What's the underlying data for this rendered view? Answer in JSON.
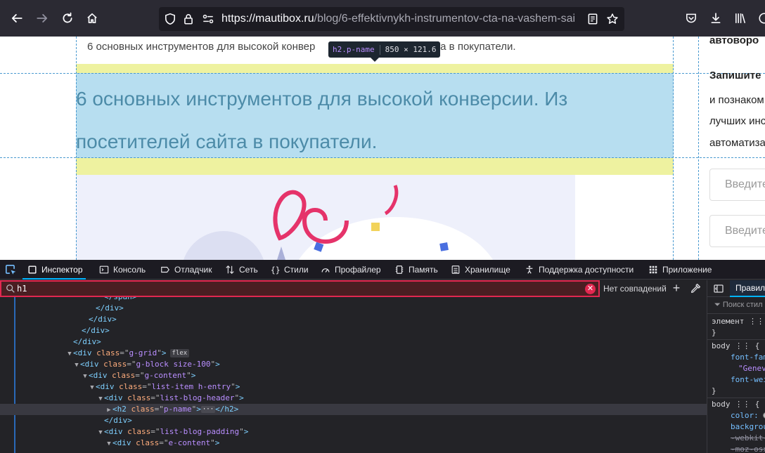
{
  "toolbar": {
    "url_domain": "https://mautibox.ru",
    "url_path": "/blog/6-effektivnykh-instrumentov-cta-na-vashem-sai"
  },
  "page": {
    "breadcrumb": "6 основных инструментов для высокой конвер",
    "breadcrumb_tail": "ей сайта в покупатели.",
    "heading": "6 основных инструментов для высокой конверсии. Из посетителей сайта в покупатели.",
    "tooltip_selector": "h2.p-name",
    "tooltip_size": "850 × 121.6",
    "sidebar": {
      "line1": "автоворо",
      "line2": "Запишите",
      "line3": "и познаком",
      "line4": "лучших инс",
      "line5": "автоматиза",
      "input1_placeholder": "Введите",
      "input2_placeholder": "Введите"
    }
  },
  "devtools": {
    "tabs": [
      {
        "label": "Инспектор",
        "icon": "inspector-icon"
      },
      {
        "label": "Консоль",
        "icon": "console-icon"
      },
      {
        "label": "Отладчик",
        "icon": "debugger-icon"
      },
      {
        "label": "Сеть",
        "icon": "network-icon"
      },
      {
        "label": "Стили",
        "icon": "style-editor-icon"
      },
      {
        "label": "Профайлер",
        "icon": "profiler-icon"
      },
      {
        "label": "Память",
        "icon": "memory-icon"
      },
      {
        "label": "Хранилище",
        "icon": "storage-icon"
      },
      {
        "label": "Поддержка доступности",
        "icon": "accessibility-icon"
      },
      {
        "label": "Приложение",
        "icon": "application-icon"
      }
    ],
    "search_value": "h1",
    "no_match": "Нет совпадений",
    "markup": [
      {
        "t": "close",
        "text": "</span>"
      },
      {
        "t": "close",
        "text": "</div>"
      },
      {
        "t": "close",
        "text": "</div>"
      },
      {
        "t": "close",
        "text": "</div>"
      },
      {
        "t": "close",
        "text": "</div>"
      },
      {
        "t": "open",
        "tag": "div",
        "attr": "class",
        "val": "g-grid",
        "badge": "flex"
      },
      {
        "t": "open",
        "tag": "div",
        "attr": "class",
        "val": "g-block size-100"
      },
      {
        "t": "open",
        "tag": "div",
        "attr": "class",
        "val": "g-content"
      },
      {
        "t": "open",
        "tag": "div",
        "attr": "class",
        "val": "list-item h-entry"
      },
      {
        "t": "open",
        "tag": "div",
        "attr": "class",
        "val": "list-blog-header"
      },
      {
        "t": "collapsed",
        "tag": "h2",
        "attr": "class",
        "val": "p-name"
      },
      {
        "t": "close",
        "text": "</div>"
      },
      {
        "t": "open",
        "tag": "div",
        "attr": "class",
        "val": "list-blog-padding"
      },
      {
        "t": "open",
        "tag": "div",
        "attr": "class",
        "val": "e-content"
      }
    ],
    "rules_tab": "Правил",
    "filter_placeholder": "Поиск стил",
    "rules": {
      "element_label": "элемент",
      "close_brace": "}",
      "body1_selector": "body",
      "body1_prop1": "font-fam",
      "body1_val1": "\"Genev",
      "body1_prop2": "font-wei",
      "body2_selector": "body",
      "body2_prop1": "color:",
      "body2_prop2": "backgrou",
      "body2_prop3": "-webkit-",
      "body2_prop4": "-moz-osx"
    }
  }
}
